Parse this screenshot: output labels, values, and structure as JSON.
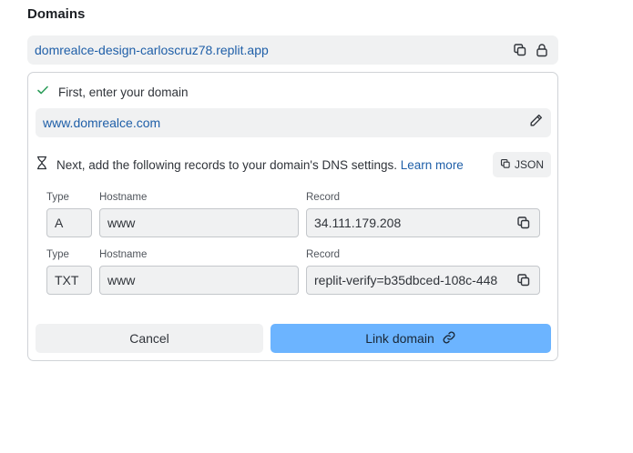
{
  "section": {
    "title": "Domains"
  },
  "dev_url": {
    "value": "domrealce-design-carloscruz78.replit.app"
  },
  "step1": {
    "label": "First, enter your domain",
    "domain_value": "www.domrealce.com"
  },
  "step2": {
    "label": "Next, add the following records to your domain's DNS settings.",
    "learn_more": "Learn more",
    "json_button": "JSON"
  },
  "columns": {
    "type": "Type",
    "hostname": "Hostname",
    "record": "Record"
  },
  "records": [
    {
      "type": "A",
      "hostname": "www",
      "record": "34.111.179.208"
    },
    {
      "type": "TXT",
      "hostname": "www",
      "record": "replit-verify=b35dbced-108c-448"
    }
  ],
  "actions": {
    "cancel": "Cancel",
    "link": "Link domain"
  },
  "colors": {
    "link_text": "#1f5fa8",
    "primary_button": "#6cb4ff",
    "check": "#2e9e5b",
    "field_bg": "#f0f1f2"
  },
  "icons": [
    "copy-icon",
    "lock-icon",
    "check-icon",
    "pencil-icon",
    "hourglass-icon",
    "link-icon"
  ]
}
